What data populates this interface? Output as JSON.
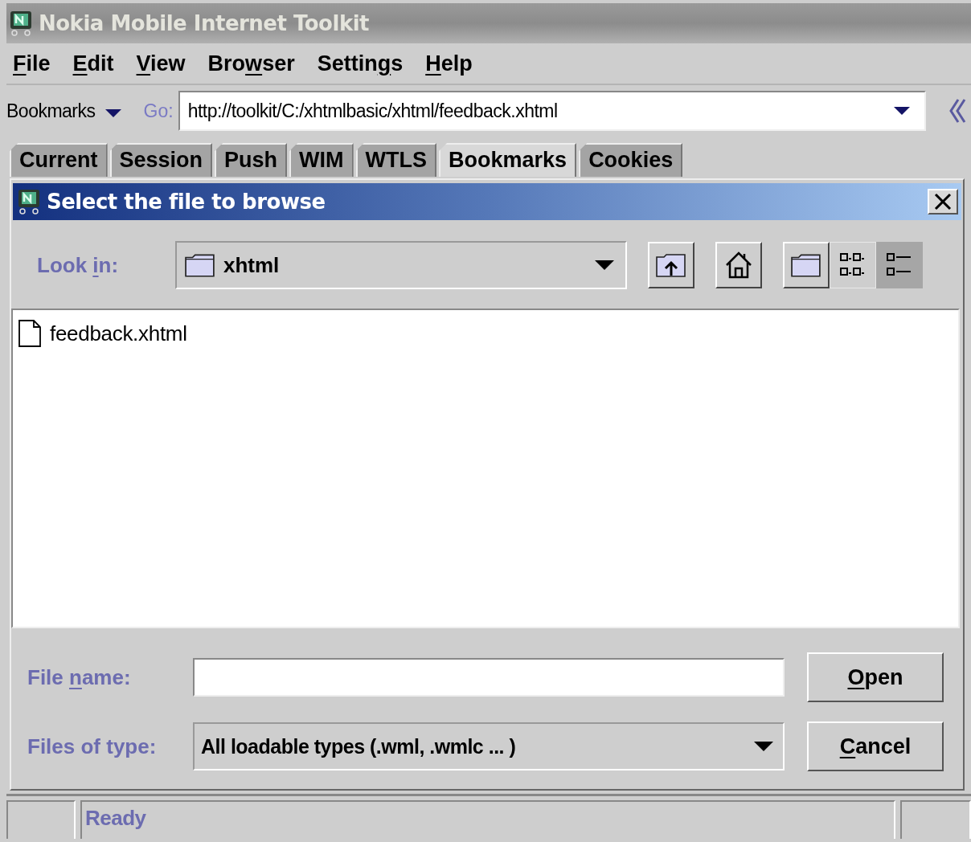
{
  "window": {
    "title": "Nokia Mobile Internet Toolkit"
  },
  "menu": [
    {
      "key": "F",
      "post": "ile"
    },
    {
      "key": "E",
      "post": "dit"
    },
    {
      "key": "V",
      "post": "iew"
    },
    {
      "pre": "Bro",
      "key": "w",
      "post": "ser"
    },
    {
      "pre": "Settin",
      "key": "g",
      "post": "s"
    },
    {
      "key": "H",
      "post": "elp"
    }
  ],
  "toolbar": {
    "bookmarks": "Bookmarks",
    "go_label": "Go:",
    "url": "http://toolkit/C:/xhtmlbasic/xhtml/feedback.xhtml"
  },
  "tabs": [
    {
      "label": "Current",
      "selected": false
    },
    {
      "label": "Session",
      "selected": false
    },
    {
      "label": "Push",
      "selected": false
    },
    {
      "label": "WIM",
      "selected": false
    },
    {
      "label": "WTLS",
      "selected": false
    },
    {
      "label": "Bookmarks",
      "selected": true
    },
    {
      "label": "Cookies",
      "selected": false
    }
  ],
  "dialog": {
    "title": "Select the file to browse",
    "look_in": {
      "pre": "Look ",
      "key": "i",
      "post": "n:"
    },
    "folder": "xhtml",
    "view_buttons": [
      {
        "kind": "list",
        "selected": false
      },
      {
        "kind": "details",
        "selected": true
      }
    ],
    "files": [
      "feedback.xhtml"
    ],
    "file_name_label": {
      "pre": "File ",
      "key": "n",
      "post": "ame:"
    },
    "file_type_label": {
      "pre": "Files of type:"
    },
    "file_type": "All loadable types (.wml, .wmlc ... )",
    "buttons": [
      {
        "key": "O",
        "post": "pen"
      },
      {
        "key": "C",
        "post": "ancel"
      }
    ]
  },
  "status_bar": {
    "text": "Ready"
  }
}
